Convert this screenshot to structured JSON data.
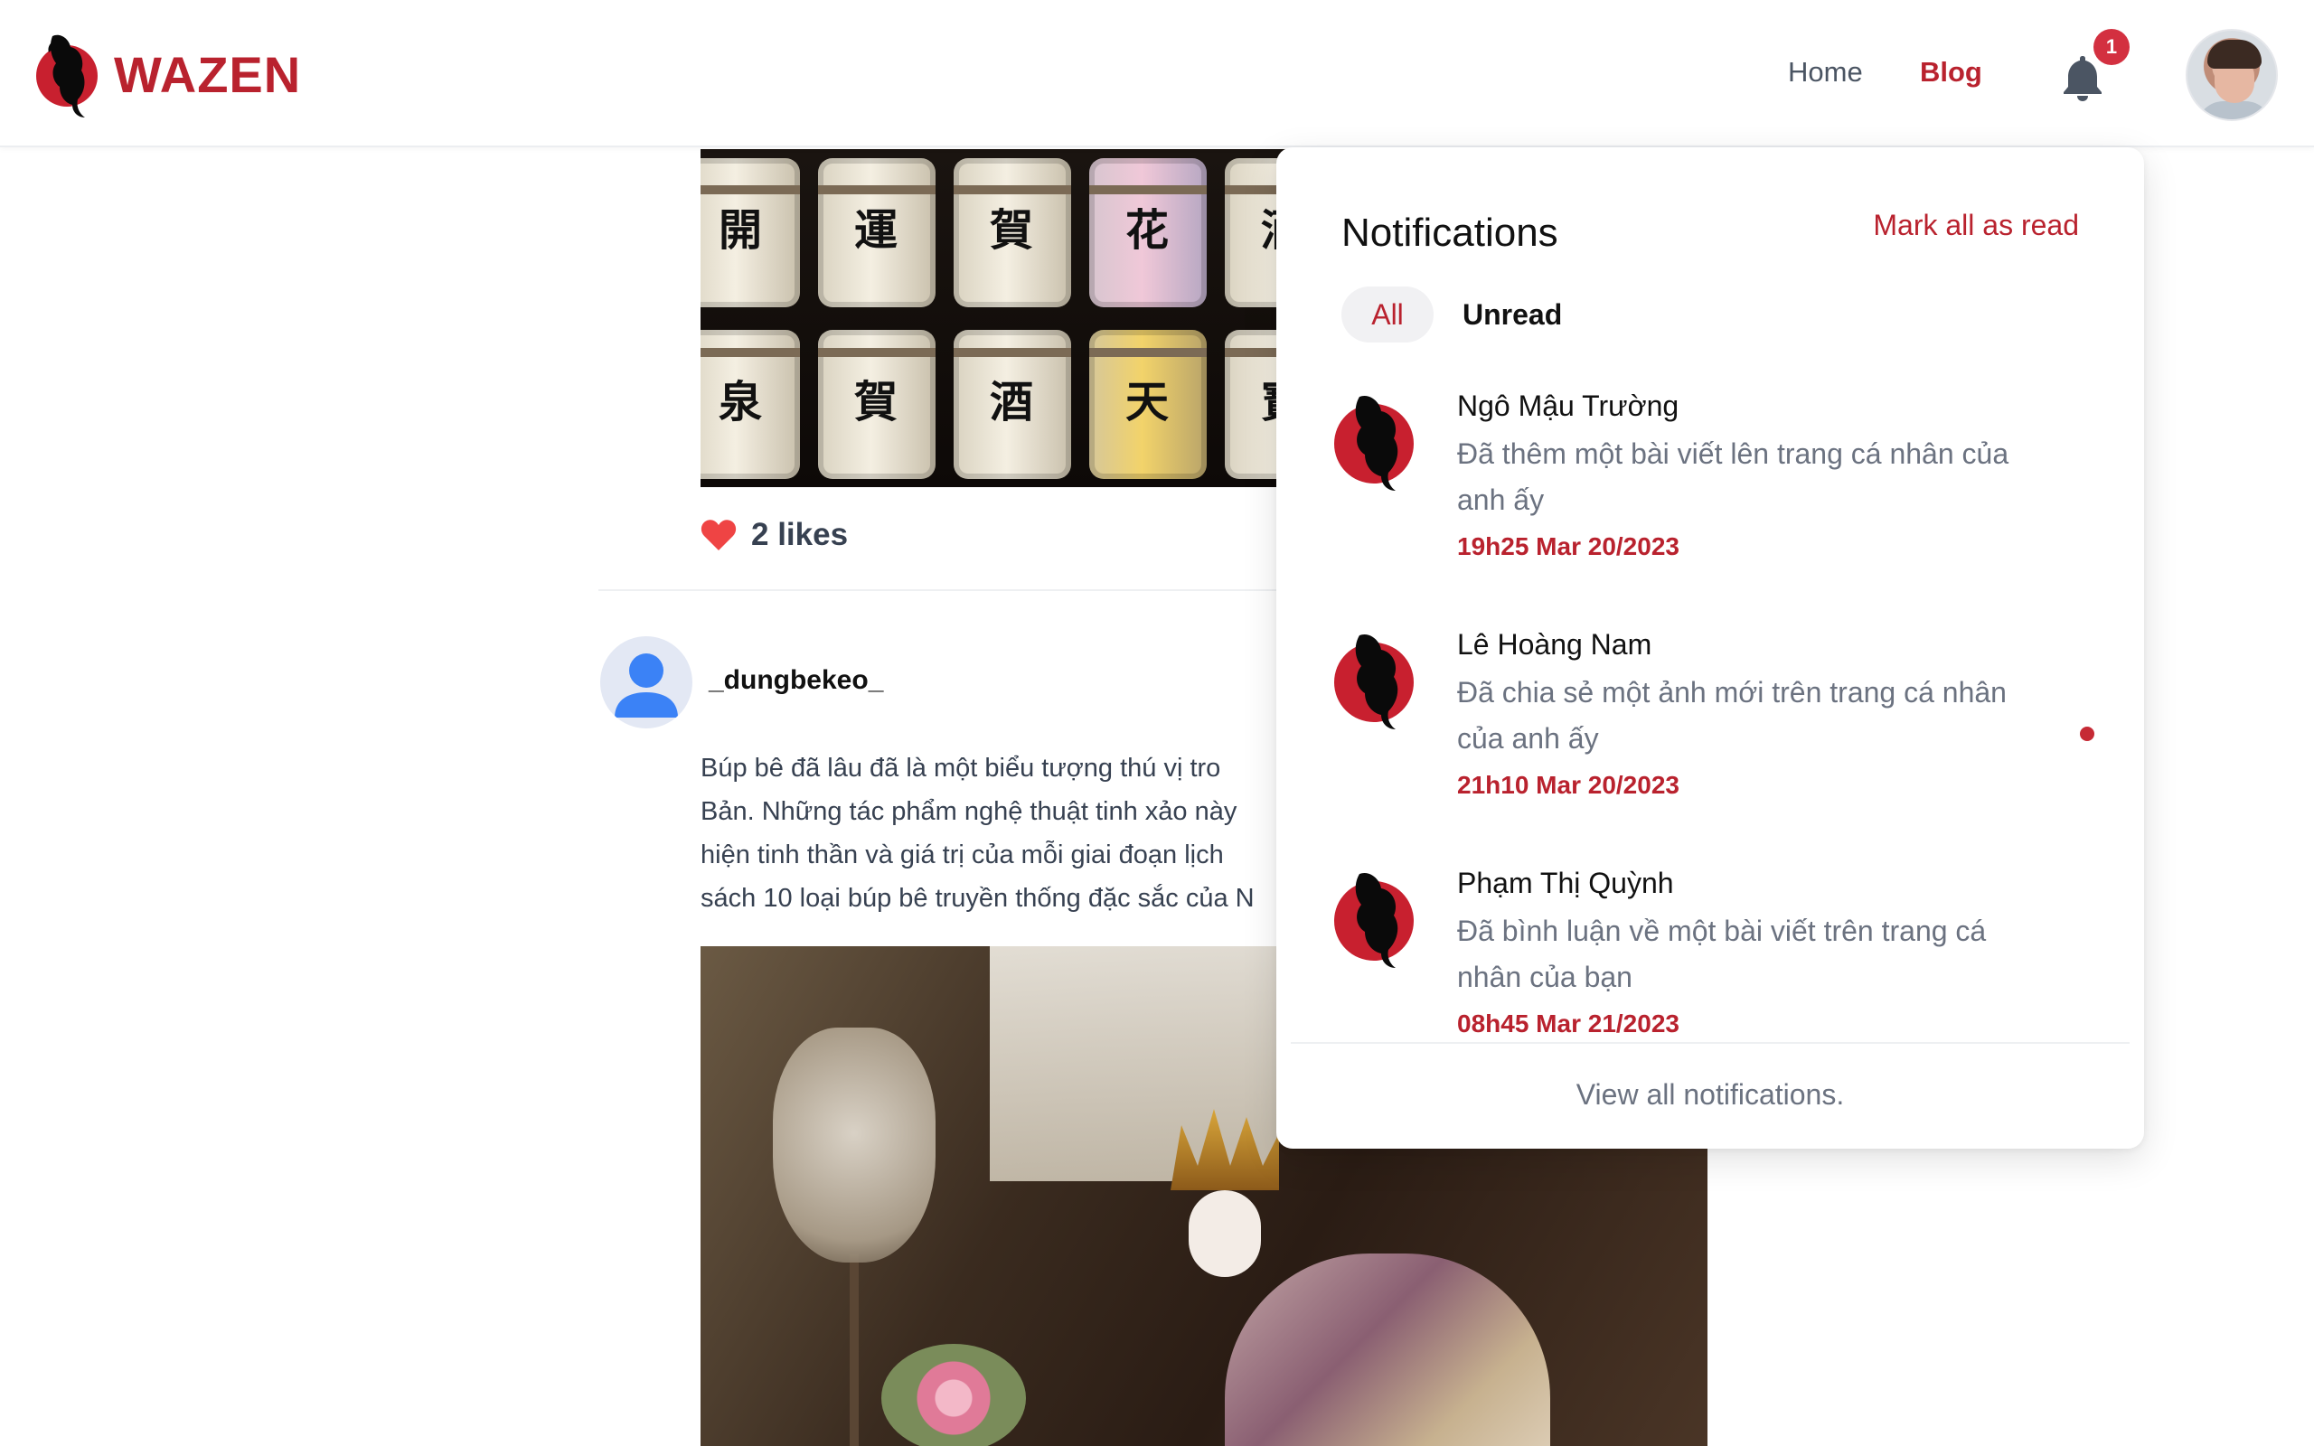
{
  "header": {
    "brand": "WAZEN",
    "nav": {
      "home": "Home",
      "blog": "Blog"
    },
    "notification_count": "1",
    "colors": {
      "brand": "#b9222e",
      "badge": "#d33040"
    }
  },
  "feed": {
    "post1": {
      "likes_text": "2 likes"
    },
    "post2": {
      "author": "_dungbekeo_",
      "text_lines": [
        "Búp bê đã lâu đã là một biểu tượng thú vị tro",
        "Bản. Những tác phẩm nghệ thuật tinh xảo này",
        "hiện tinh thần và giá trị của mỗi giai đoạn lịch",
        "sách 10 loại búp bê truyền thống đặc sắc của N"
      ]
    }
  },
  "notifications": {
    "title": "Notifications",
    "mark_all": "Mark all as read",
    "tabs": {
      "all": "All",
      "unread": "Unread"
    },
    "items": [
      {
        "name": "Ngô Mậu Trường",
        "message": "Đã thêm một bài viết lên trang cá nhân của anh ấy",
        "time": "19h25 Mar 20/2023",
        "unread": false
      },
      {
        "name": "Lê Hoàng Nam",
        "message": "Đã chia sẻ một ảnh mới trên trang cá nhân của anh ấy",
        "time": "21h10 Mar 20/2023",
        "unread": true
      },
      {
        "name": "Phạm Thị Quỳnh",
        "message": "Đã bình luận về một bài viết trên trang cá nhân của bạn",
        "time": "08h45 Mar 21/2023",
        "unread": false
      }
    ],
    "footer": "View all notifications."
  }
}
